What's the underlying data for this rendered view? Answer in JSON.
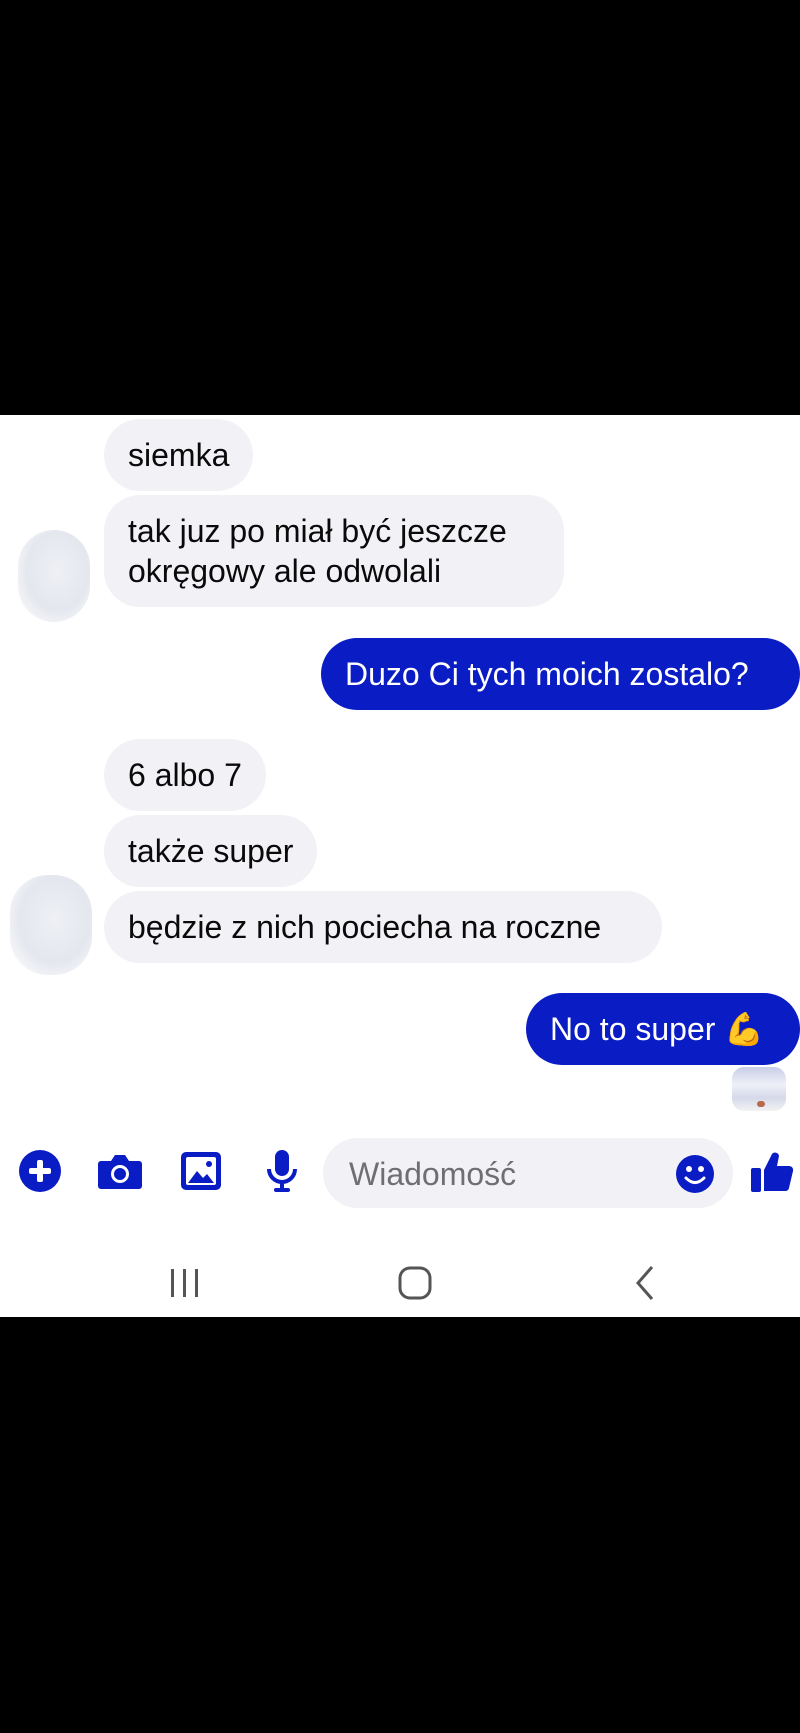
{
  "colors": {
    "accent": "#0a1cc4",
    "incoming_bubble": "#f1f1f6",
    "background": "#ffffff"
  },
  "messages": [
    {
      "side": "in",
      "text": "siemka"
    },
    {
      "side": "in",
      "text": "tak juz po miał być jeszcze",
      "text2": "okręgowy ale odwolali"
    },
    {
      "side": "out",
      "text": "Duzo Ci tych moich zostalo?"
    },
    {
      "side": "in",
      "text": "6 albo 7"
    },
    {
      "side": "in",
      "text": "także super"
    },
    {
      "side": "in",
      "text": "będzie z nich pociecha na roczne"
    },
    {
      "side": "out",
      "text": "No to super",
      "emoji": "💪"
    }
  ],
  "composer": {
    "placeholder": "Wiadomość"
  },
  "toolbar": [
    "plus-icon",
    "camera-icon",
    "image-icon",
    "microphone-icon",
    "emoji-icon",
    "thumbs-up-icon"
  ],
  "navigation": [
    "recent-apps-icon",
    "home-icon",
    "back-icon"
  ]
}
